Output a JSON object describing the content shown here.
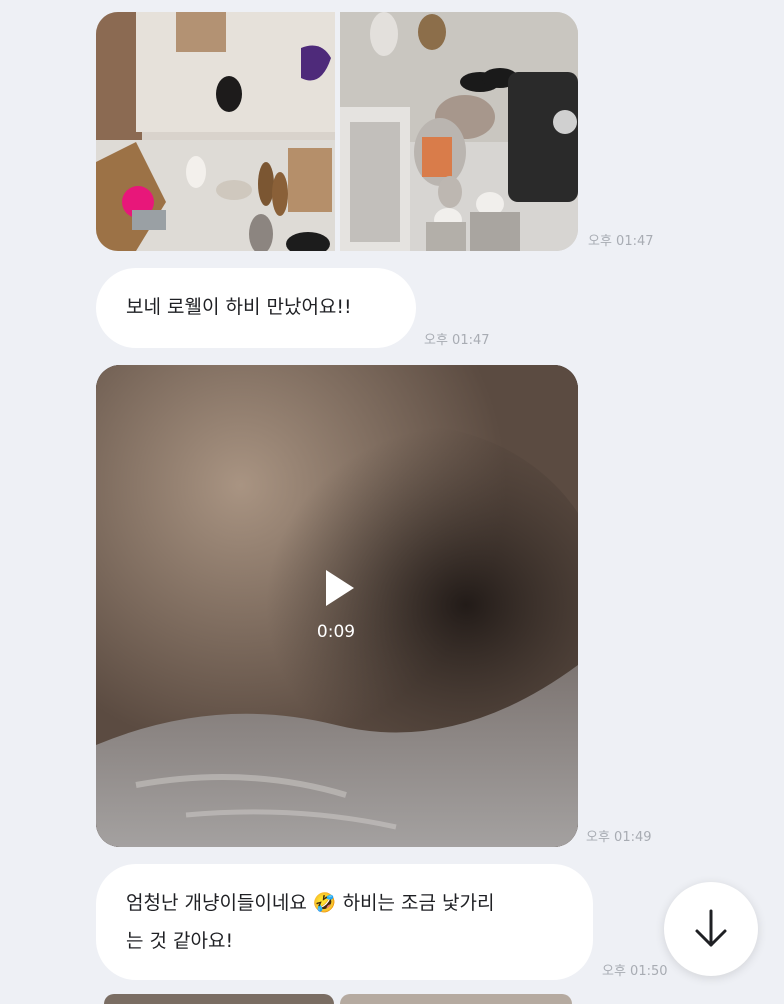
{
  "messages": [
    {
      "type": "photo_pair",
      "time": "오후 01:47"
    },
    {
      "type": "text",
      "text": "보네 로웰이 하비 만났어요!!",
      "time": "오후 01:47"
    },
    {
      "type": "video",
      "duration": "0:09",
      "time": "오후 01:49"
    },
    {
      "type": "text",
      "text_line1": "엄청난 개냥이들이네요 🤣 하비는 조금 낯가리",
      "text_line2": "는 것 같아요!",
      "time": "오후 01:50"
    }
  ],
  "controls": {
    "scroll_down_icon": "arrow-down-icon",
    "play_icon": "play-icon"
  },
  "colors": {
    "background": "#eef0f5",
    "bubble": "#ffffff",
    "timestamp": "#a8acb3"
  }
}
